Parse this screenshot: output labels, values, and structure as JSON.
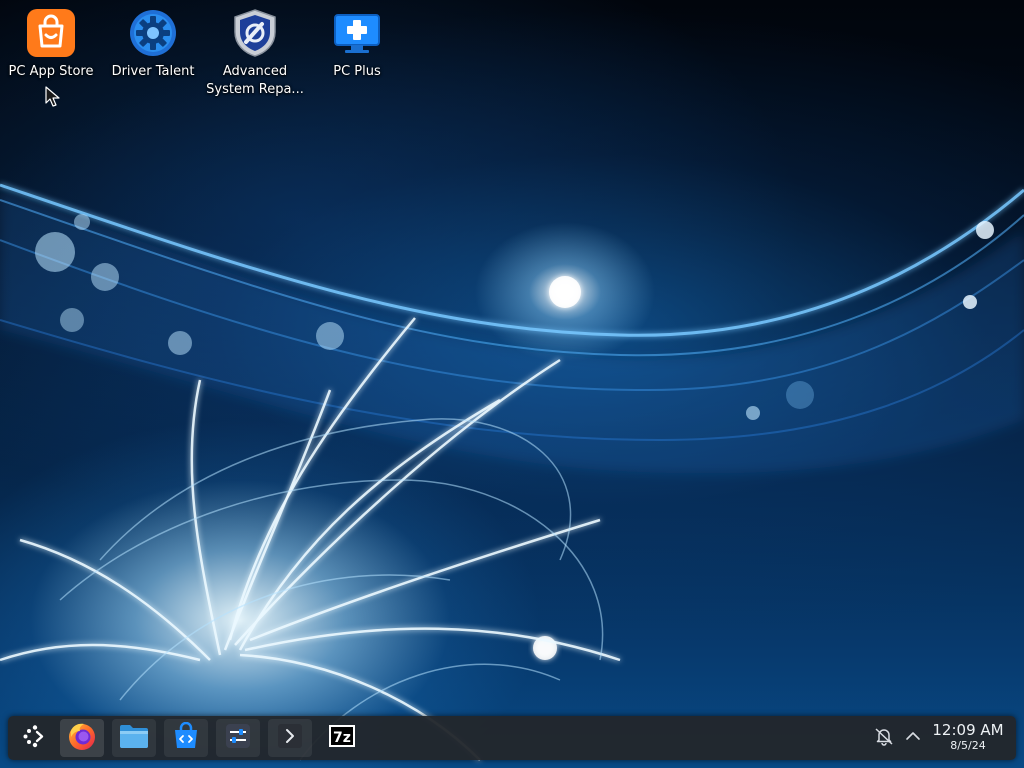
{
  "desktop": {
    "icons": [
      {
        "label": "PC App Store",
        "icon": "shopping-bag-icon"
      },
      {
        "label": "Driver Talent",
        "icon": "gear-icon"
      },
      {
        "label": "Advanced\nSystem Repa...",
        "icon": "shield-wrench-icon"
      },
      {
        "label": "PC Plus",
        "icon": "monitor-plus-icon"
      }
    ]
  },
  "taskbar": {
    "launcher_icon": "application-launcher-icon",
    "apps": [
      {
        "name": "Firefox",
        "icon": "firefox-icon"
      },
      {
        "name": "Files",
        "icon": "folder-icon"
      },
      {
        "name": "Discover",
        "icon": "store-bag-icon"
      },
      {
        "name": "System Settings",
        "icon": "settings-sliders-icon"
      },
      {
        "name": "Konsole",
        "icon": "terminal-icon"
      },
      {
        "name": "7-Zip",
        "icon": "7z-icon",
        "text": "7z"
      }
    ],
    "tray": {
      "notification_icon": "notifications-bell-icon",
      "expand_icon": "chevron-up-icon"
    },
    "clock": {
      "time": "12:09 AM",
      "date": "8/5/24"
    }
  },
  "colors": {
    "taskbar_bg": "#22262c",
    "accent_blue": "#1e8cff",
    "app_store_orange": "#ff7a1a"
  }
}
